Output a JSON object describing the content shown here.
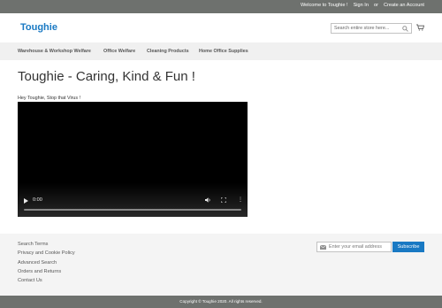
{
  "topbar": {
    "welcome": "Welcome to Toughie !",
    "sign_in": "Sign In",
    "or": "or",
    "create_account": "Create an Account"
  },
  "header": {
    "logo": "Toughie",
    "search_placeholder": "Search entire store here..."
  },
  "nav": {
    "items": [
      {
        "label": "Warehouse & Workshop Welfare"
      },
      {
        "label": "Office Welfare"
      },
      {
        "label": "Cleaning Products"
      },
      {
        "label": "Home Office Supplies"
      }
    ]
  },
  "main": {
    "title": "Toughie - Caring, Kind & Fun !",
    "caption": "Hey Toughie, Stop that Virus !",
    "video": {
      "time": "0:00",
      "progress": 0
    }
  },
  "footer": {
    "links": [
      {
        "label": "Search Terms"
      },
      {
        "label": "Privacy and Cookie Policy"
      },
      {
        "label": "Advanced Search"
      },
      {
        "label": "Orders and Returns"
      },
      {
        "label": "Contact Us"
      }
    ],
    "newsletter_placeholder": "Enter your email address",
    "subscribe_label": "Subscribe",
    "copyright": "Copyright © Toughie 2020. All rights reserved."
  },
  "colors": {
    "brand": "#1979c3",
    "topbar": "#6e716e",
    "nav": "#f0f0f0",
    "footer": "#f4f4f4"
  }
}
